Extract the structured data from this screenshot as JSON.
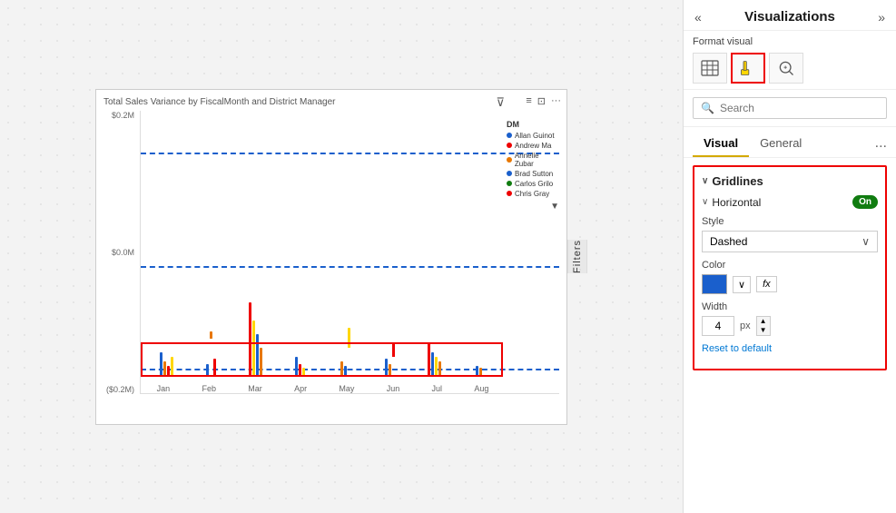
{
  "panel": {
    "title": "Visualizations",
    "collapse_left": "«",
    "collapse_right": "»",
    "format_visual_label": "Format visual",
    "format_icons": [
      {
        "name": "table-icon",
        "symbol": "⊞",
        "active": false
      },
      {
        "name": "bar-paint-icon",
        "symbol": "🖌",
        "active": true,
        "highlighted": true
      },
      {
        "name": "analytics-icon",
        "symbol": "🔍",
        "active": false
      }
    ],
    "search": {
      "placeholder": "Search",
      "icon": "🔍"
    },
    "tabs": [
      {
        "label": "Visual",
        "active": true
      },
      {
        "label": "General",
        "active": false
      }
    ],
    "tabs_dots": "...",
    "gridlines": {
      "section_title": "Gridlines",
      "horizontal": {
        "label": "Horizontal",
        "toggle": "On",
        "style_label": "Style",
        "style_value": "Dashed",
        "color_label": "Color",
        "color_hex": "#1a5fcc",
        "width_label": "Width",
        "width_value": "4",
        "width_unit": "px",
        "reset_label": "Reset to default"
      }
    }
  },
  "filters": {
    "label": "Filters"
  },
  "chart": {
    "title": "Total Sales Variance by FiscalMonth and District Manager",
    "y_labels": [
      "$0.2M",
      "$0.0M",
      "($0.2M)"
    ],
    "x_labels": [
      "Jan",
      "Feb",
      "Mar",
      "Apr",
      "May",
      "Jun",
      "Jul",
      "Aug"
    ],
    "legend_title": "DM",
    "legend_items": [
      {
        "name": "Allan Guinot",
        "color": "#1a5fcc"
      },
      {
        "name": "Andrew Ma",
        "color": "#e00"
      },
      {
        "name": "Annelle Zubar",
        "color": "#e87700"
      },
      {
        "name": "Brad Sutton",
        "color": "#1a5fcc"
      },
      {
        "name": "Carlos Grilo",
        "color": "#107c10"
      },
      {
        "name": "Chris Gray",
        "color": "#e00"
      }
    ]
  }
}
